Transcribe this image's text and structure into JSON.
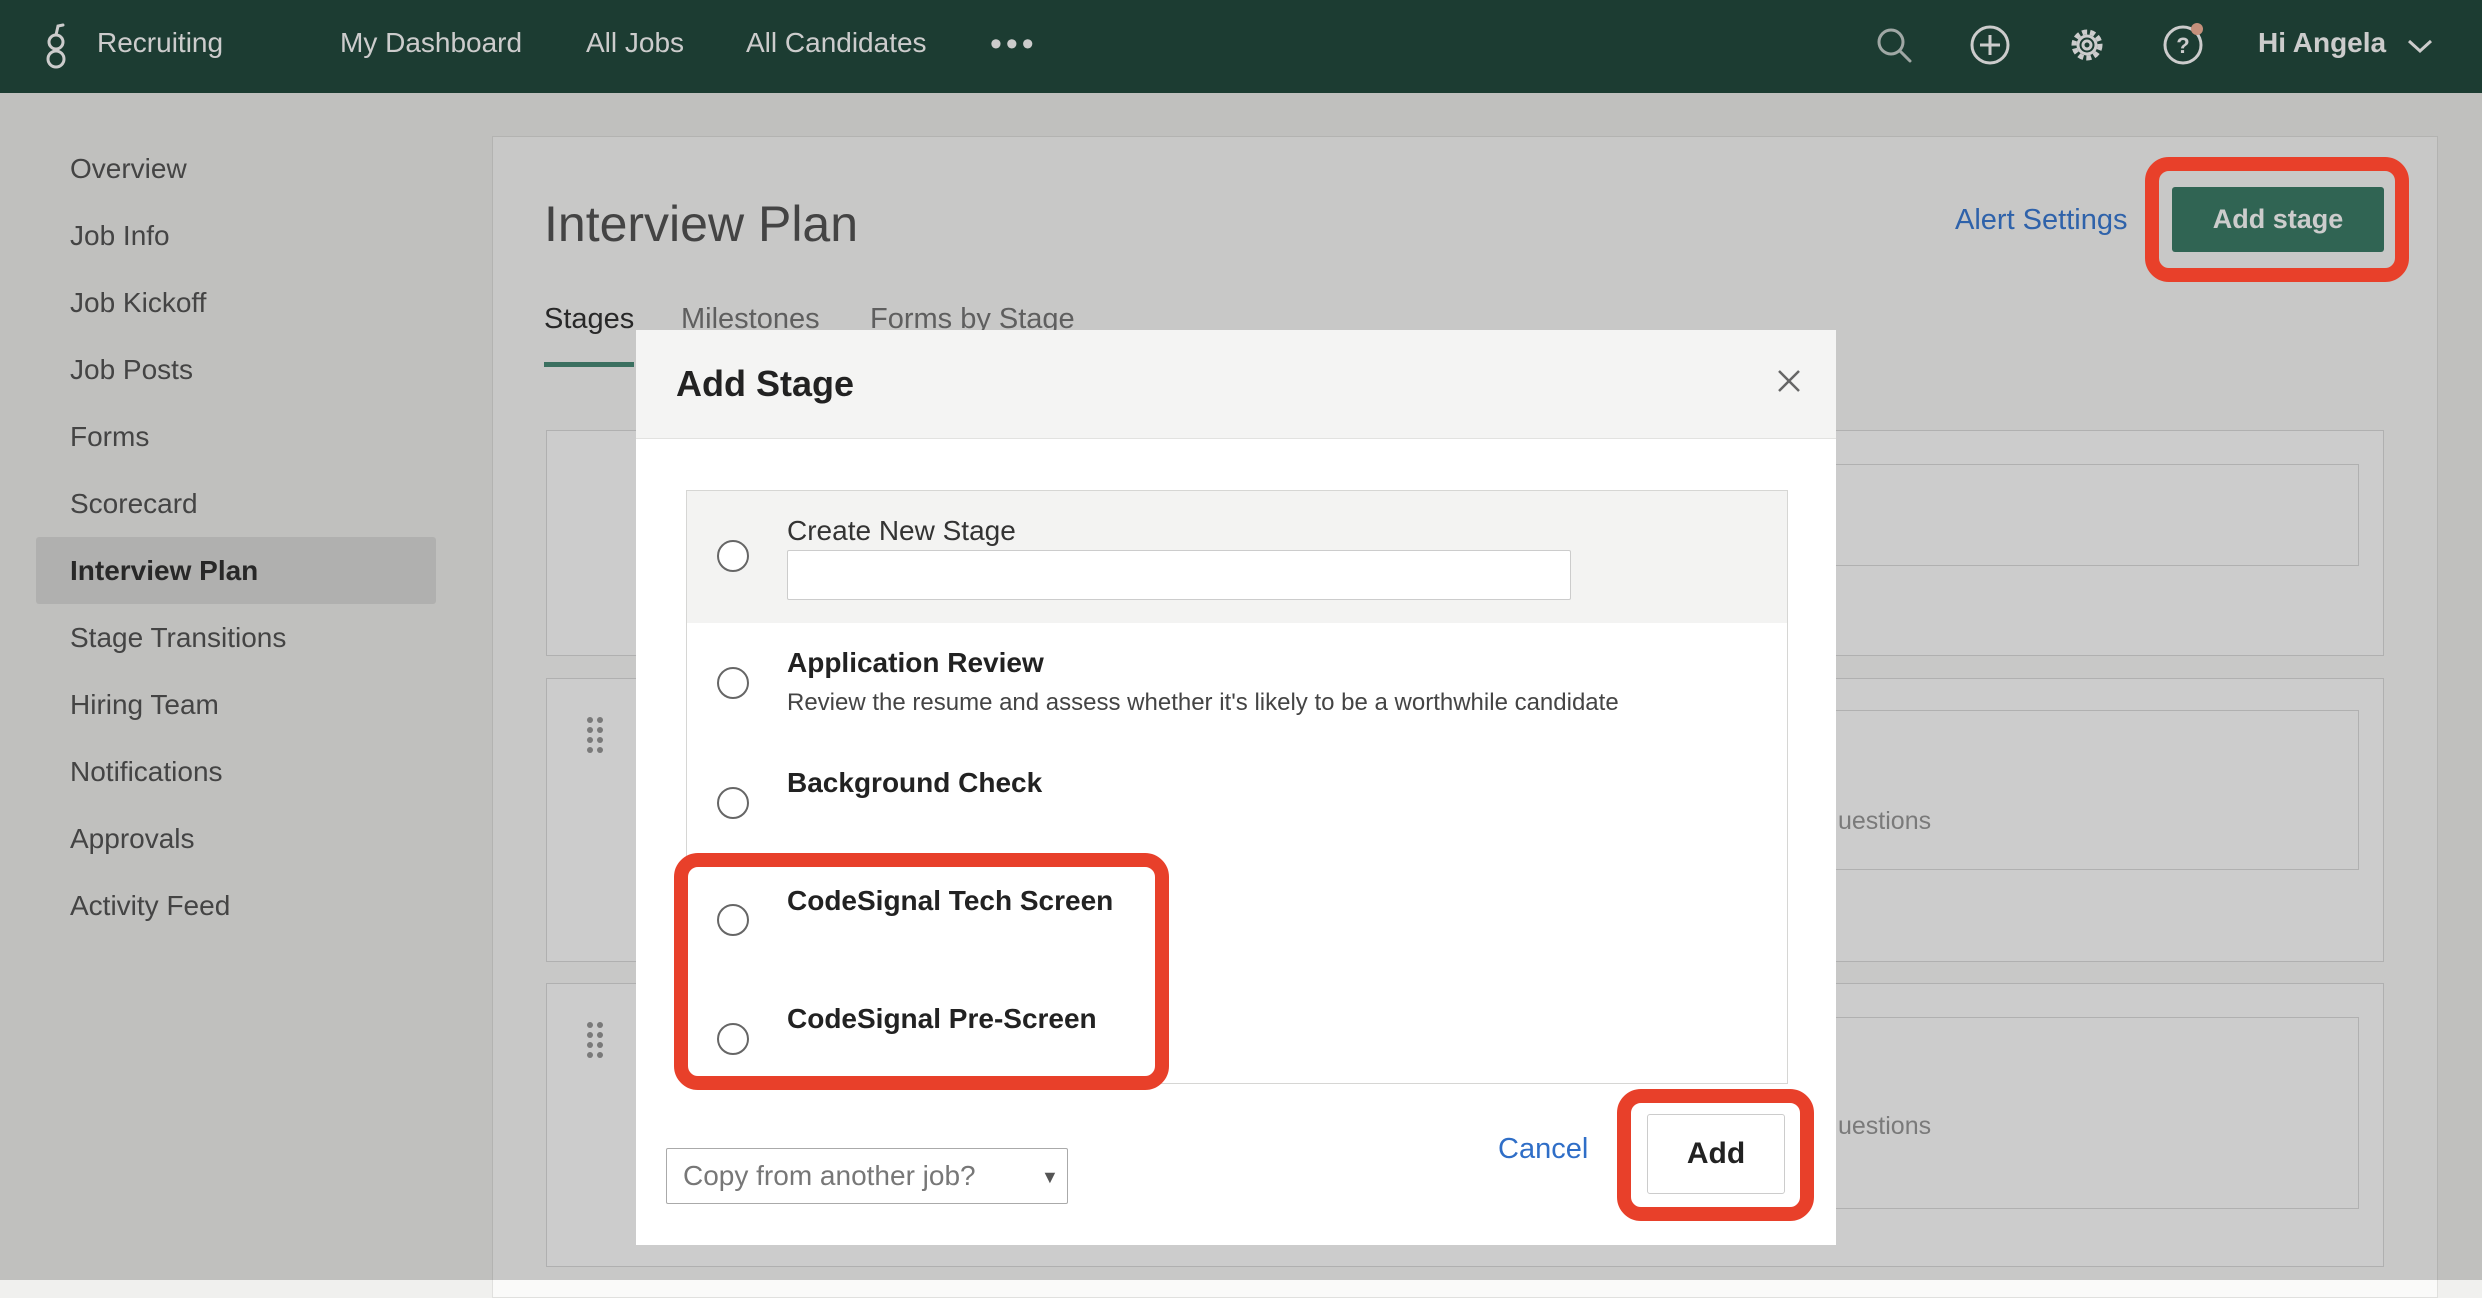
{
  "topnav": {
    "app_name": "Recruiting",
    "links": [
      "My Dashboard",
      "All Jobs",
      "All Candidates"
    ],
    "more": "•••",
    "icons": [
      "search-icon",
      "add-circle-icon",
      "gear-icon",
      "help-icon"
    ],
    "greeting": "Hi Angela",
    "notification_dot_color": "#f7b49a"
  },
  "sidebar": {
    "items": [
      {
        "label": "Overview"
      },
      {
        "label": "Job Info"
      },
      {
        "label": "Job Kickoff"
      },
      {
        "label": "Job Posts"
      },
      {
        "label": "Forms"
      },
      {
        "label": "Scorecard"
      },
      {
        "label": "Interview Plan",
        "active": true
      },
      {
        "label": "Stage Transitions"
      },
      {
        "label": "Hiring Team"
      },
      {
        "label": "Notifications"
      },
      {
        "label": "Approvals"
      },
      {
        "label": "Activity Feed"
      }
    ]
  },
  "main": {
    "title": "Interview Plan",
    "alert_settings": "Alert Settings",
    "add_stage_button": "Add stage",
    "tabs": [
      {
        "label": "Stages",
        "active": true
      },
      {
        "label": "Milestones"
      },
      {
        "label": "Forms by Stage"
      }
    ],
    "ghost_texts": [
      "uestions",
      "uestions"
    ]
  },
  "modal": {
    "title": "Add Stage",
    "options": [
      {
        "label": "Create New Stage",
        "input_value": ""
      },
      {
        "label": "Application Review",
        "description": "Review the resume and assess whether it's likely to be a worthwhile candidate"
      },
      {
        "label": "Background Check"
      },
      {
        "label": "CodeSignal Tech Screen"
      },
      {
        "label": "CodeSignal Pre-Screen"
      }
    ],
    "copy_select_placeholder": "Copy from another job?",
    "cancel": "Cancel",
    "add": "Add"
  },
  "colors": {
    "topbar": "#244b3f",
    "accent_green": "#3c7d68",
    "highlight_red": "#e8402a",
    "link_blue": "#2f6ec7"
  }
}
